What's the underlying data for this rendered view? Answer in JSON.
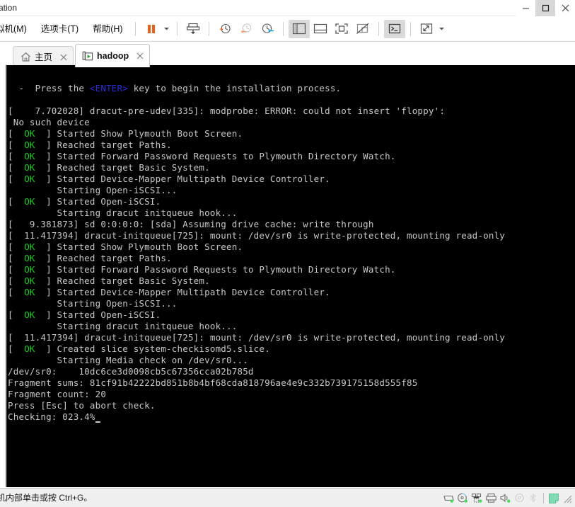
{
  "window": {
    "title": "ation",
    "controls": {
      "minimize": "minimize",
      "maximize": "maximize",
      "close": "close"
    }
  },
  "menubar": {
    "items": [
      {
        "label": "拟机(M)",
        "accel": "M"
      },
      {
        "label": "选项卡(T)",
        "accel": "T"
      },
      {
        "label": "帮助(H)",
        "accel": "H"
      }
    ],
    "toolbar": [
      {
        "name": "suspend-button",
        "icon": "pause-icon"
      },
      {
        "name": "suspend-dropdown",
        "icon": "chevron-down-icon"
      },
      {
        "name": "snapshot-button",
        "icon": "snapshot-take-icon"
      },
      {
        "name": "snapshot-manager-button",
        "icon": "clock-plus-icon"
      },
      {
        "name": "revert-snapshot-button",
        "icon": "clock-revert-icon"
      },
      {
        "name": "manage-snapshots-button",
        "icon": "clock-wrench-icon"
      },
      {
        "name": "show-library-button",
        "icon": "panel-left-icon"
      },
      {
        "name": "show-thumbnail-bar-button",
        "icon": "panel-bottom-icon"
      },
      {
        "name": "fullscreen-button",
        "icon": "fullscreen-icon"
      },
      {
        "name": "unity-mode-button",
        "icon": "unity-off-icon"
      },
      {
        "name": "console-button",
        "icon": "terminal-icon"
      },
      {
        "name": "stretch-button",
        "icon": "expand-arrows-icon"
      },
      {
        "name": "stretch-dropdown",
        "icon": "chevron-down-icon"
      }
    ]
  },
  "tabs": [
    {
      "label": "主页",
      "icon": "home-icon",
      "active": false,
      "close": "close-icon"
    },
    {
      "label": "hadoop",
      "icon": "vm-play-icon",
      "active": true,
      "close": "close-icon"
    }
  ],
  "terminal": {
    "lines": [
      {
        "segments": [
          {
            "t": "  -  Press the "
          },
          {
            "t": "<ENTER>",
            "c": "enter"
          },
          {
            "t": " key to begin the installation process."
          }
        ]
      },
      {
        "segments": [
          {
            "t": ""
          }
        ]
      },
      {
        "segments": [
          {
            "t": "[    7.702028] dracut-pre-udev[335]: modprobe: ERROR: could not insert 'floppy':"
          }
        ]
      },
      {
        "segments": [
          {
            "t": " No such device"
          }
        ]
      },
      {
        "segments": [
          {
            "t": "[  "
          },
          {
            "t": "OK",
            "c": "ok"
          },
          {
            "t": "  ] Started Show Plymouth Boot Screen."
          }
        ]
      },
      {
        "segments": [
          {
            "t": "[  "
          },
          {
            "t": "OK",
            "c": "ok"
          },
          {
            "t": "  ] Reached target Paths."
          }
        ]
      },
      {
        "segments": [
          {
            "t": "[  "
          },
          {
            "t": "OK",
            "c": "ok"
          },
          {
            "t": "  ] Started Forward Password Requests to Plymouth Directory Watch."
          }
        ]
      },
      {
        "segments": [
          {
            "t": "[  "
          },
          {
            "t": "OK",
            "c": "ok"
          },
          {
            "t": "  ] Reached target Basic System."
          }
        ]
      },
      {
        "segments": [
          {
            "t": "[  "
          },
          {
            "t": "OK",
            "c": "ok"
          },
          {
            "t": "  ] Started Device-Mapper Multipath Device Controller."
          }
        ]
      },
      {
        "segments": [
          {
            "t": "         Starting Open-iSCSI..."
          }
        ]
      },
      {
        "segments": [
          {
            "t": "[  "
          },
          {
            "t": "OK",
            "c": "ok"
          },
          {
            "t": "  ] Started Open-iSCSI."
          }
        ]
      },
      {
        "segments": [
          {
            "t": "         Starting dracut initqueue hook..."
          }
        ]
      },
      {
        "segments": [
          {
            "t": "[   9.381873] sd 0:0:0:0: [sda] Assuming drive cache: write through"
          }
        ]
      },
      {
        "segments": [
          {
            "t": "[  11.417394] dracut-initqueue[725]: mount: /dev/sr0 is write-protected, mounting read-only"
          }
        ]
      },
      {
        "segments": [
          {
            "t": "[  "
          },
          {
            "t": "OK",
            "c": "ok"
          },
          {
            "t": "  ] Started Show Plymouth Boot Screen."
          }
        ]
      },
      {
        "segments": [
          {
            "t": "[  "
          },
          {
            "t": "OK",
            "c": "ok"
          },
          {
            "t": "  ] Reached target Paths."
          }
        ]
      },
      {
        "segments": [
          {
            "t": "[  "
          },
          {
            "t": "OK",
            "c": "ok"
          },
          {
            "t": "  ] Started Forward Password Requests to Plymouth Directory Watch."
          }
        ]
      },
      {
        "segments": [
          {
            "t": "[  "
          },
          {
            "t": "OK",
            "c": "ok"
          },
          {
            "t": "  ] Reached target Basic System."
          }
        ]
      },
      {
        "segments": [
          {
            "t": "[  "
          },
          {
            "t": "OK",
            "c": "ok"
          },
          {
            "t": "  ] Started Device-Mapper Multipath Device Controller."
          }
        ]
      },
      {
        "segments": [
          {
            "t": "         Starting Open-iSCSI..."
          }
        ]
      },
      {
        "segments": [
          {
            "t": "[  "
          },
          {
            "t": "OK",
            "c": "ok"
          },
          {
            "t": "  ] Started Open-iSCSI."
          }
        ]
      },
      {
        "segments": [
          {
            "t": "         Starting dracut initqueue hook..."
          }
        ]
      },
      {
        "segments": [
          {
            "t": "[  11.417394] dracut-initqueue[725]: mount: /dev/sr0 is write-protected, mounting read-only"
          }
        ]
      },
      {
        "segments": [
          {
            "t": "[  "
          },
          {
            "t": "OK",
            "c": "ok"
          },
          {
            "t": "  ] Created slice system-checkisomd5.slice."
          }
        ]
      },
      {
        "segments": [
          {
            "t": "         Starting Media check on /dev/sr0..."
          }
        ]
      },
      {
        "segments": [
          {
            "t": "/dev/sr0:    10dc6ce3d0098cb5c67356cca02b785d"
          }
        ]
      },
      {
        "segments": [
          {
            "t": "Fragment sums: 81cf91b42222bd851b8b4bf68cda818796ae4e9c332b739175158d555f85"
          }
        ]
      },
      {
        "segments": [
          {
            "t": "Fragment count: 20"
          }
        ]
      },
      {
        "segments": [
          {
            "t": "Press [Esc] to abort check."
          }
        ]
      },
      {
        "segments": [
          {
            "t": "Checking: 023.4%"
          },
          {
            "t": "",
            "c": "cursor"
          }
        ]
      }
    ]
  },
  "statusbar": {
    "hint": "机内部单击或按 Ctrl+G。",
    "devices": [
      {
        "name": "hard-disk-icon"
      },
      {
        "name": "cd-dvd-icon"
      },
      {
        "name": "network-adapter-icon"
      },
      {
        "name": "printer-icon"
      },
      {
        "name": "sound-card-icon"
      },
      {
        "name": "usb-device-icon"
      },
      {
        "name": "bluetooth-device-icon"
      }
    ],
    "note_icon": "note-icon",
    "resize_grip": "resize-grip-icon"
  },
  "colors": {
    "terminal_bg": "#000000",
    "terminal_fg": "#c8c8c8",
    "ok_green": "#1ec81e",
    "enter_blue": "#2b2bd6",
    "accent_orange": "#e8601c",
    "chrome_bg": "#ffffff",
    "statusbar_bg": "#f0f0f0"
  }
}
